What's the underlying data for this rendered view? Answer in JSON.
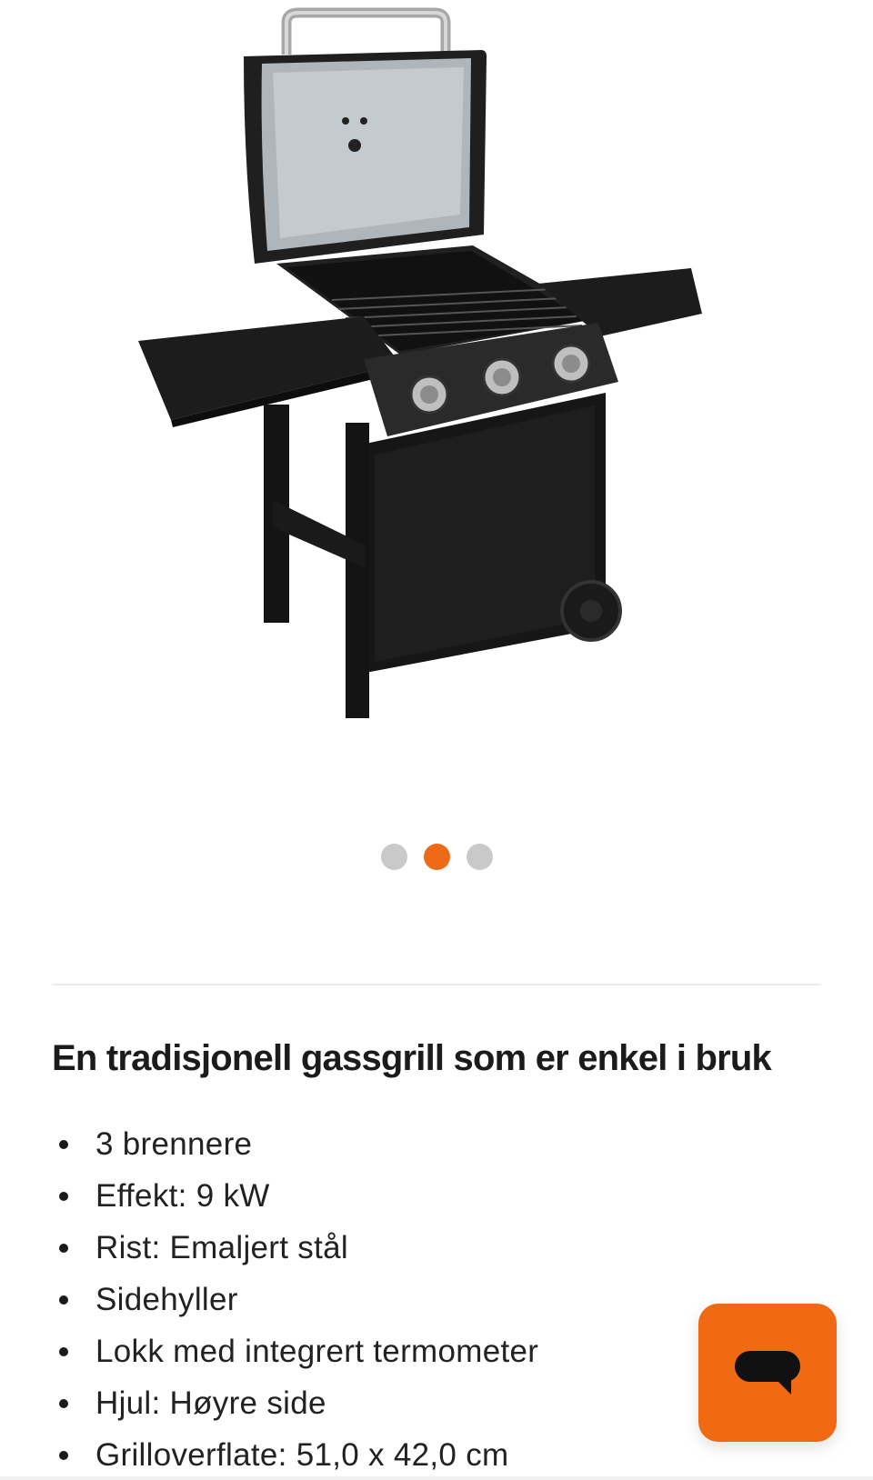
{
  "gallery": {
    "image_name": "gas-grill-product-image",
    "dots": [
      {
        "active": false
      },
      {
        "active": true
      },
      {
        "active": false
      }
    ],
    "accent_color": "#ee6a16"
  },
  "product": {
    "heading": "En tradisjonell gassgrill som er enkel i bruk",
    "features": [
      "3 brennere",
      "Effekt: 9 kW",
      "Rist: Emaljert stål",
      "Sidehyller",
      "Lokk med integrert termometer",
      "Hjul: Høyre side",
      "Grilloverflate: 51,0 x 42,0 cm"
    ]
  },
  "chat": {
    "icon": "chat-bubble-icon",
    "color": "#ef6a12"
  }
}
